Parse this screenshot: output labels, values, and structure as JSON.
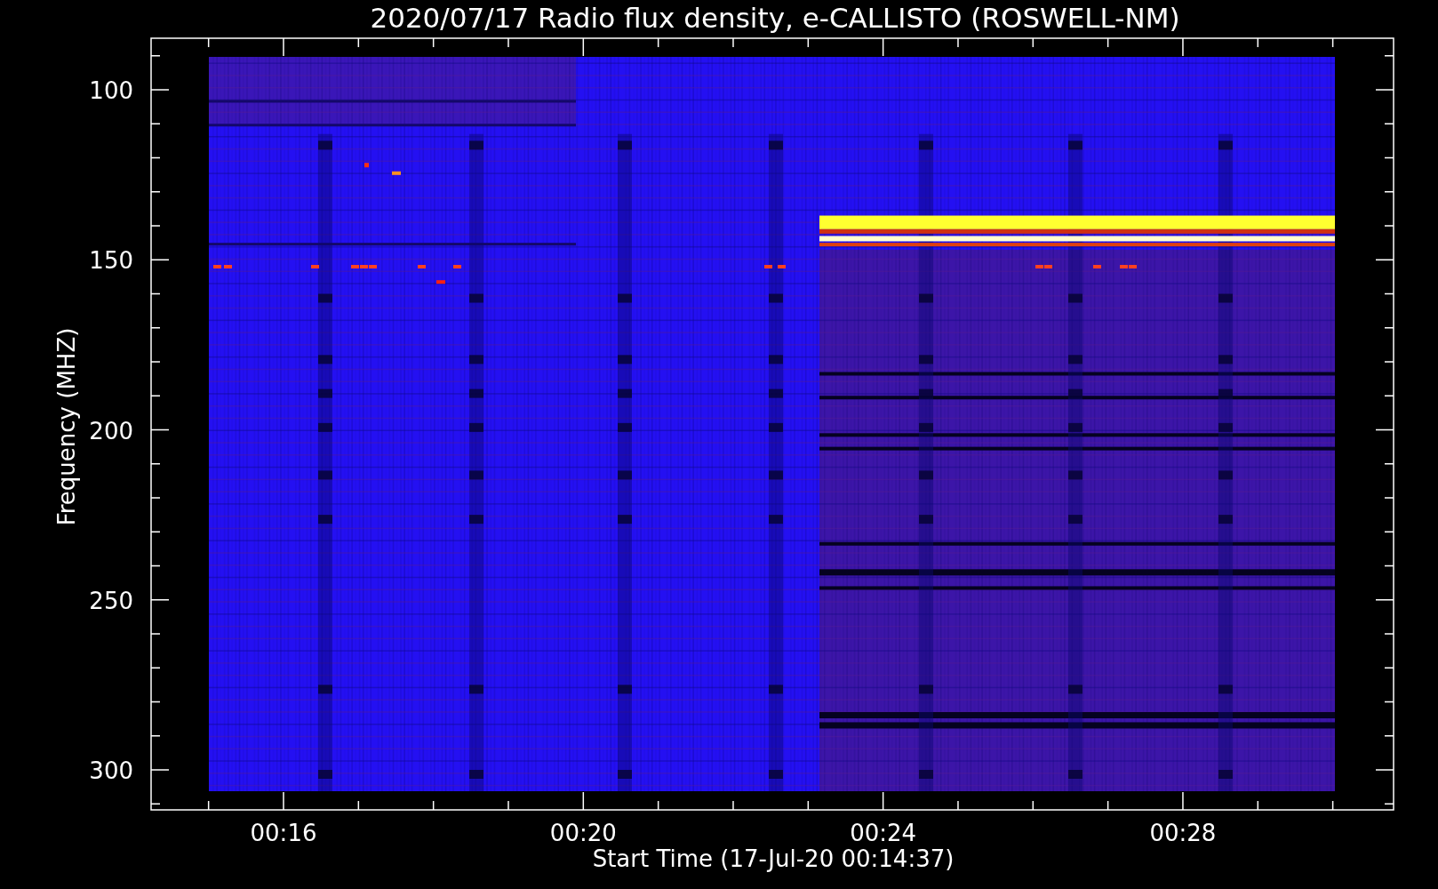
{
  "title": "2020/07/17  Radio flux density, e-CALLISTO (ROSWELL-NM)",
  "x_axis": {
    "label": "Start Time (17-Jul-20 00:14:37)",
    "ticks": [
      "00:16",
      "00:20",
      "00:24",
      "00:28"
    ]
  },
  "y_axis": {
    "label": "Frequency (MHZ)",
    "ticks": [
      "100",
      "150",
      "200",
      "250",
      "300"
    ]
  }
}
